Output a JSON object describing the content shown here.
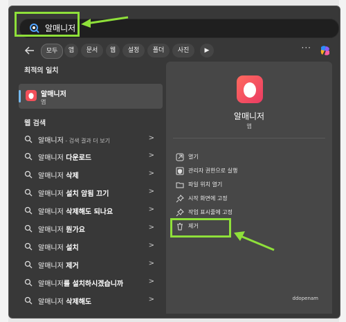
{
  "search": {
    "value": "알매니저"
  },
  "filters": {
    "chips": [
      "모두",
      "앱",
      "문서",
      "웹",
      "설정",
      "폴더",
      "사진"
    ],
    "next_label": "▶",
    "more_label": "···"
  },
  "best_match": {
    "section_title": "최적의 일치",
    "app_name": "알매니저",
    "app_type": "앱"
  },
  "web_search": {
    "section_title": "웹 검색",
    "items": [
      {
        "bold": "알매니저",
        "rest": "",
        "sub": " - 검색 결과 더 보기"
      },
      {
        "bold": "알매니저",
        "rest": " 다운로드",
        "sub": ""
      },
      {
        "bold": "알매니저",
        "rest": " 삭제",
        "sub": ""
      },
      {
        "bold": "알매니저",
        "rest": " 설치 암됨 끄기",
        "sub": ""
      },
      {
        "bold": "알매니저",
        "rest": " 삭제해도 되나요",
        "sub": ""
      },
      {
        "bold": "알매니저",
        "rest": " 뭔가요",
        "sub": ""
      },
      {
        "bold": "알매니저",
        "rest": " 설치",
        "sub": ""
      },
      {
        "bold": "알매니저",
        "rest": " 제거",
        "sub": ""
      },
      {
        "bold": "알매니저",
        "rest": "를 설치하시겠습니까",
        "sub": ""
      },
      {
        "bold": "알매니저",
        "rest": " 삭제해도",
        "sub": ""
      }
    ]
  },
  "detail": {
    "app_name": "알매니저",
    "app_type": "앱",
    "actions": [
      {
        "icon": "open-icon",
        "label": "열기"
      },
      {
        "icon": "shield-icon",
        "label": "관리자 권한으로 실행"
      },
      {
        "icon": "folder-icon",
        "label": "파일 위치 열기"
      },
      {
        "icon": "pin-icon",
        "label": "시작 화면에 고정"
      },
      {
        "icon": "pin-icon",
        "label": "작업 표시줄에 고정"
      },
      {
        "icon": "trash-icon",
        "label": "제거"
      }
    ]
  },
  "watermark": "ddopenam",
  "colors": {
    "highlight": "#8fe03a",
    "accent": "#76b9ed",
    "panel": "#383838"
  }
}
